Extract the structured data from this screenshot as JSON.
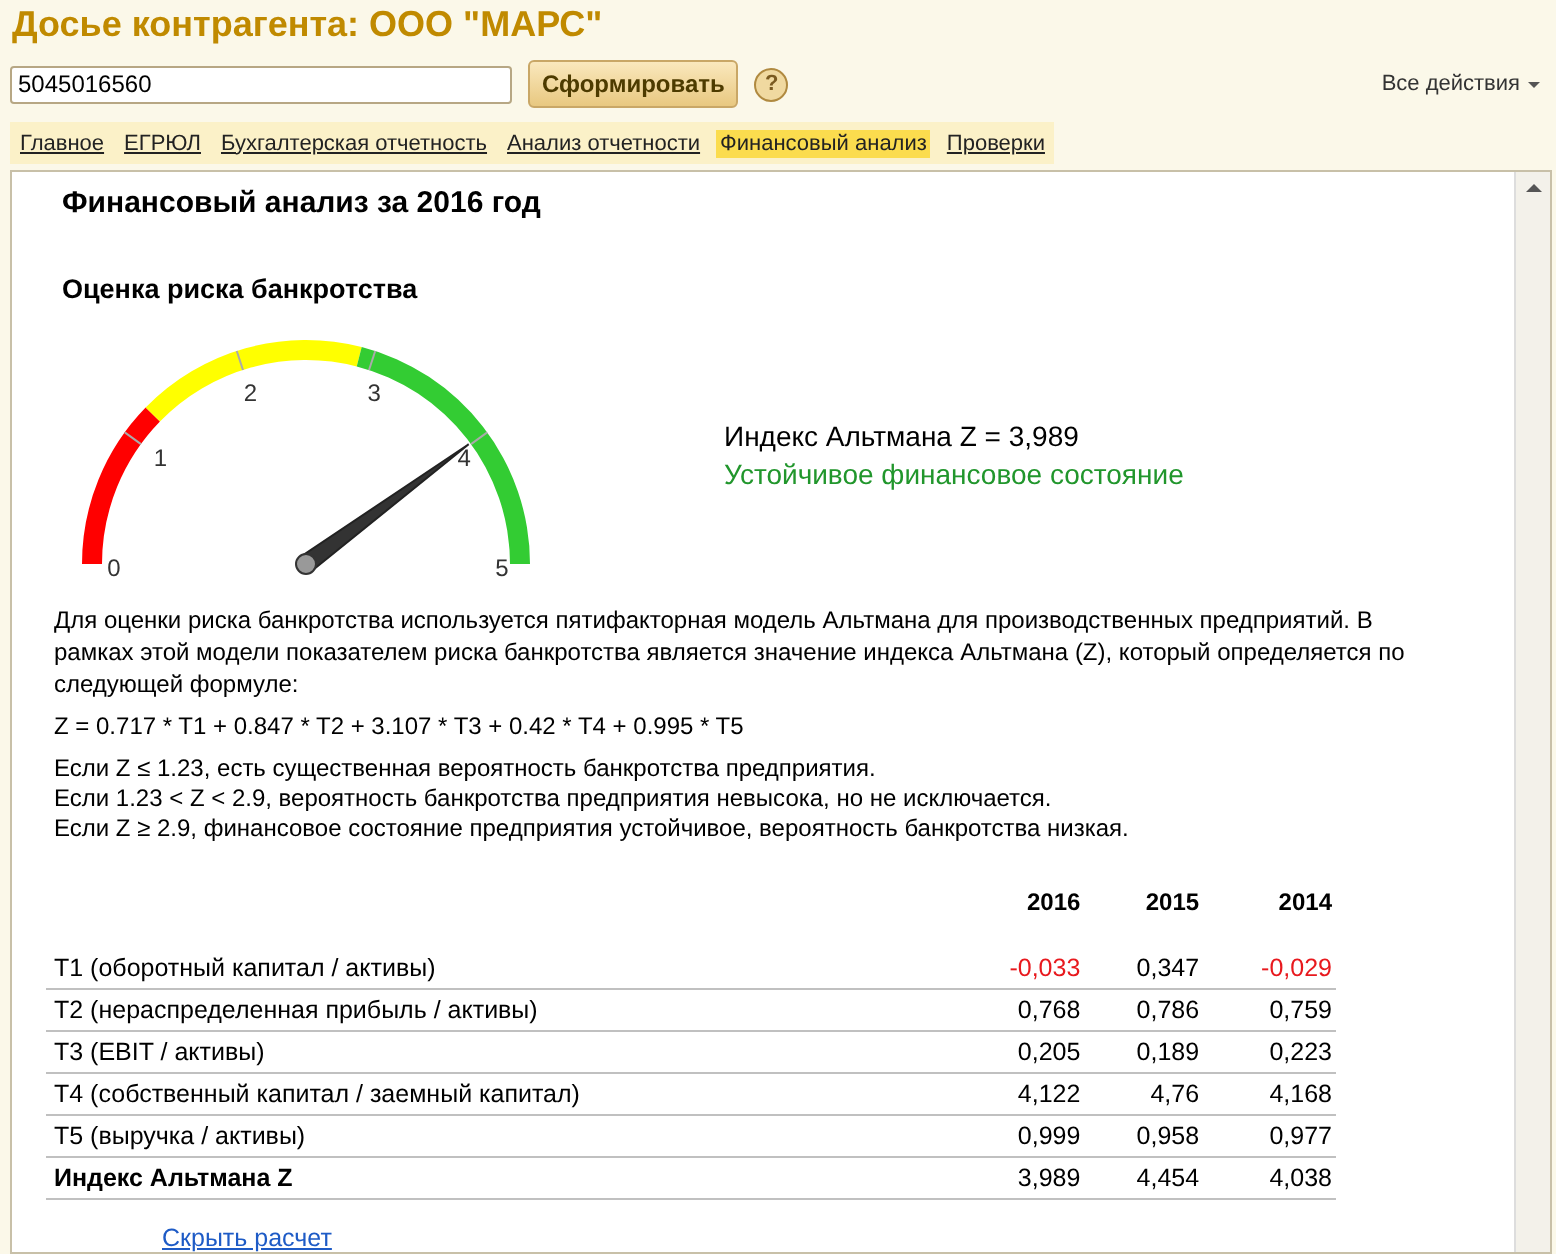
{
  "window": {
    "title": "Досье контрагента: ООО \"МАРС\""
  },
  "toolbar": {
    "search_value": "5045016560",
    "form_button": "Сформировать",
    "help_button": "?",
    "all_actions": "Все действия"
  },
  "tabs": [
    {
      "label": "Главное",
      "selected": false
    },
    {
      "label": "ЕГРЮЛ",
      "selected": false
    },
    {
      "label": "Бухгалтерская отчетность",
      "selected": false
    },
    {
      "label": "Анализ отчетности",
      "selected": false
    },
    {
      "label": "Финансовый анализ",
      "selected": true
    },
    {
      "label": "Проверки",
      "selected": false
    }
  ],
  "report": {
    "title": "Финансовый анализ за 2016 год",
    "section_title": "Оценка риска банкротства",
    "gauge": {
      "level": 0.798,
      "ticks": [
        "0",
        "1",
        "2",
        "3",
        "4",
        "5"
      ],
      "zones": [
        {
          "color": "#ff0000"
        },
        {
          "color": "#ffff00"
        },
        {
          "color": "#33cc33"
        }
      ]
    },
    "index_text": "Индекс Альтмана Z = 3,989",
    "status_text": "Устойчивое финансовое состояние",
    "description": "Для оценки риска банкротства используется пятифакторная модель Альтмана для производственных предприятий. В рамках этой модели показателем риска банкротства является значение индекса Альтмана (Z), который определяется по следующей формуле:",
    "formula": "Z = 0.717 * T1 + 0.847 * T2 + 3.107 * T3 + 0.42 * T4 + 0.995 * T5",
    "rules": [
      "Если Z ≤ 1.23, есть существенная вероятность банкротства предприятия.",
      "Если 1.23 < Z < 2.9, вероятность банкротства предприятия невысока, но не исключается.",
      "Если Z ≥ 2.9, финансовое состояние предприятия устойчивое, вероятность банкротства низкая."
    ],
    "table": {
      "columns": [
        "2016",
        "2015",
        "2014"
      ],
      "rows": [
        {
          "label": "T1 (оборотный капитал / активы)",
          "total": false,
          "values": [
            {
              "text": "-0,033",
              "negative": true
            },
            {
              "text": "0,347",
              "negative": false
            },
            {
              "text": "-0,029",
              "negative": true
            }
          ]
        },
        {
          "label": "T2 (нераспределенная прибыль / активы)",
          "total": false,
          "values": [
            {
              "text": "0,768",
              "negative": false
            },
            {
              "text": "0,786",
              "negative": false
            },
            {
              "text": "0,759",
              "negative": false
            }
          ]
        },
        {
          "label": "T3 (EBIT / активы)",
          "total": false,
          "values": [
            {
              "text": "0,205",
              "negative": false
            },
            {
              "text": "0,189",
              "negative": false
            },
            {
              "text": "0,223",
              "negative": false
            }
          ]
        },
        {
          "label": "T4 (собственный капитал / заемный капитал)",
          "total": false,
          "values": [
            {
              "text": "4,122",
              "negative": false
            },
            {
              "text": "4,76",
              "negative": false
            },
            {
              "text": "4,168",
              "negative": false
            }
          ]
        },
        {
          "label": "T5 (выручка / активы)",
          "total": false,
          "values": [
            {
              "text": "0,999",
              "negative": false
            },
            {
              "text": "0,958",
              "negative": false
            },
            {
              "text": "0,977",
              "negative": false
            }
          ]
        },
        {
          "label": "Индекс Альтмана Z",
          "total": true,
          "values": [
            {
              "text": "3,989",
              "negative": false
            },
            {
              "text": "4,454",
              "negative": false
            },
            {
              "text": "4,038",
              "negative": false
            }
          ]
        }
      ]
    },
    "hide_link": "Скрыть расчет"
  }
}
